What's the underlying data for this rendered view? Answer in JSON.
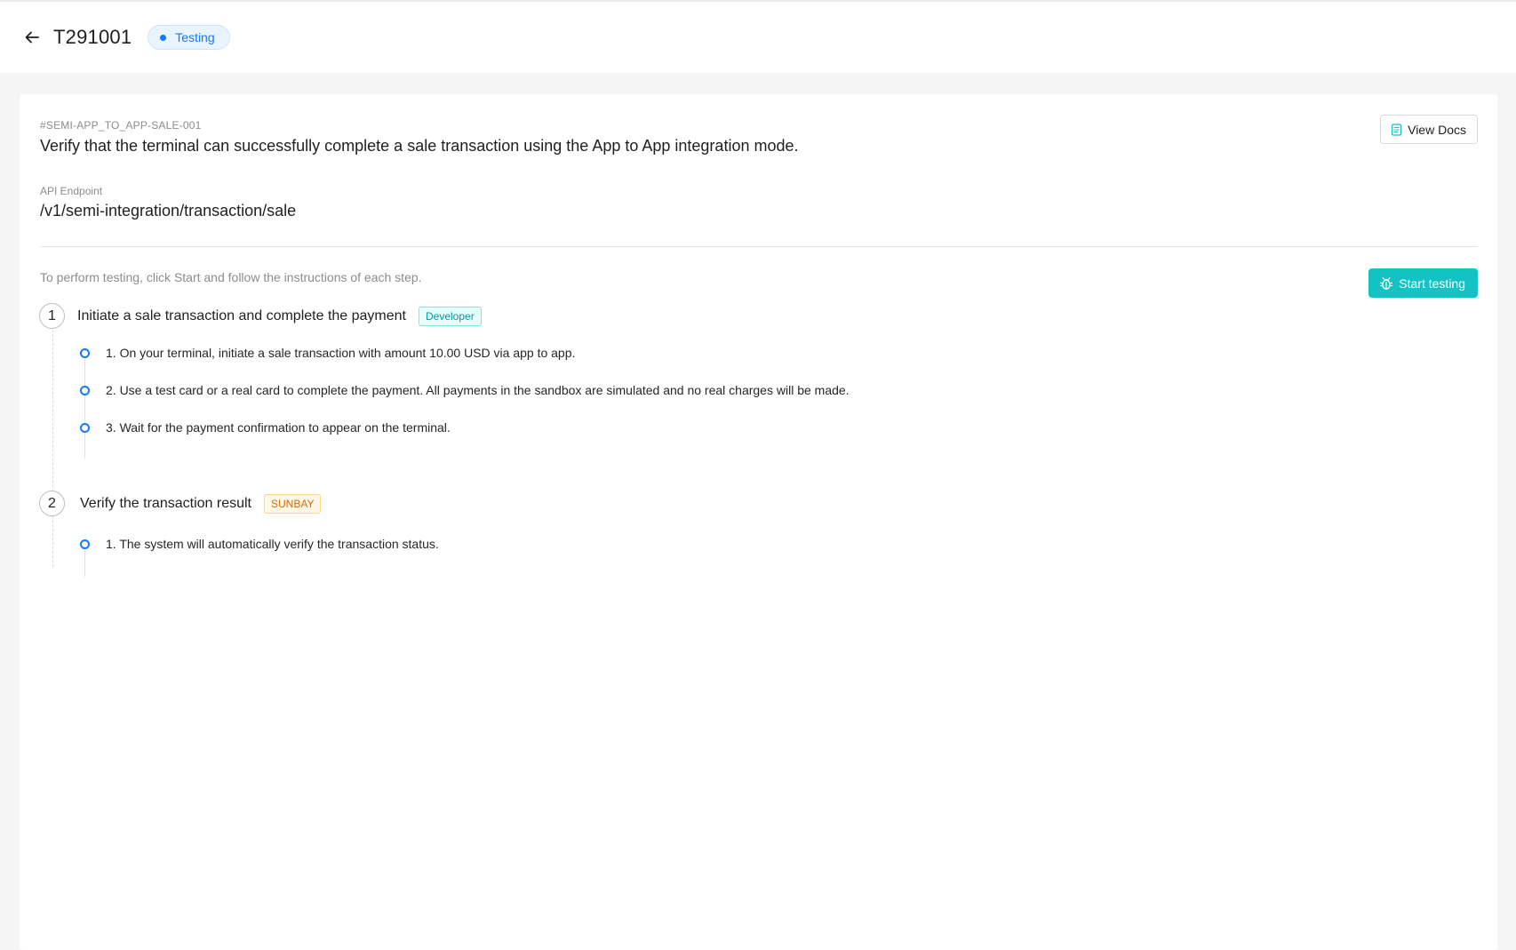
{
  "header": {
    "title": "T291001",
    "status": "Testing",
    "back_icon": "arrow-left-icon"
  },
  "case": {
    "id": "#SEMI-APP_TO_APP-SALE-001",
    "description": "Verify that the terminal can successfully complete a sale transaction using the App to App integration mode.",
    "view_docs_label": "View Docs",
    "endpoint_label": "API Endpoint",
    "endpoint": "/v1/semi-integration/transaction/sale"
  },
  "testing": {
    "instructions": "To perform testing, click Start and follow the instructions of each step.",
    "start_label": "Start testing"
  },
  "steps": [
    {
      "number": "1",
      "title": "Initiate a sale transaction and complete the payment",
      "role": "Developer",
      "items": [
        "1. On your terminal, initiate a sale transaction with amount 10.00 USD via app to app.",
        "2. Use a test card or a real card to complete the payment. All payments in the sandbox are simulated and no real charges will be made.",
        "3. Wait for the payment confirmation to appear on the terminal."
      ]
    },
    {
      "number": "2",
      "title": "Verify the transaction result",
      "role": "SUNBAY",
      "items": [
        "1. The system will automatically verify the transaction status."
      ]
    }
  ],
  "colors": {
    "primary": "#1677ff",
    "accent_teal": "#13c2c2",
    "tag_orange": "#d46b08"
  }
}
